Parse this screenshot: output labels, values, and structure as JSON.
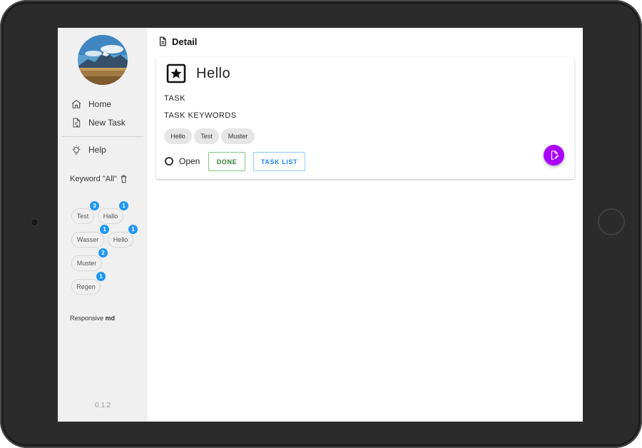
{
  "sidebar": {
    "nav": [
      {
        "label": "Home",
        "icon": "home-icon"
      },
      {
        "label": "New Task",
        "icon": "note-add-icon"
      },
      {
        "label": "Help",
        "icon": "lightbulb-icon"
      }
    ],
    "keyword_heading": "Keyword \"All\"",
    "keywords": [
      {
        "label": "Test",
        "count": "3"
      },
      {
        "label": "Hallo",
        "count": "1"
      },
      {
        "label": "Wasser",
        "count": "1"
      },
      {
        "label": "Hello",
        "count": "1"
      },
      {
        "label": "Muster",
        "count": "2"
      },
      {
        "label": "Regen",
        "count": "1"
      }
    ],
    "responsive_label": "Responsive",
    "responsive_value": "md",
    "version": "0.1.2"
  },
  "header": {
    "title": "Detail"
  },
  "task": {
    "title": "Hello",
    "task_label": "TASK",
    "keywords_label": "TASK KEYWORDS",
    "keywords": [
      "Hello",
      "Test",
      "Muster"
    ],
    "status": "Open",
    "done_label": "DONE",
    "list_label": "TASK LIST"
  },
  "colors": {
    "fab": "#aa00ff",
    "badge": "#2196f3",
    "done": "#2e7d32",
    "list": "#1e88e5"
  }
}
